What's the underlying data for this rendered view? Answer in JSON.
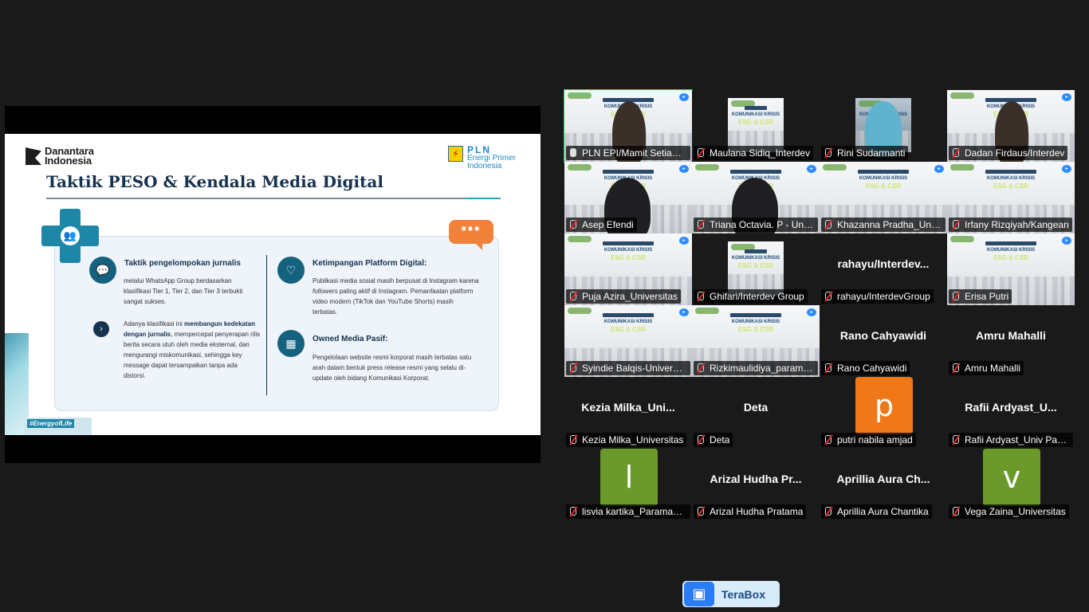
{
  "slide": {
    "logo_left": "Danantara\nIndonesia",
    "logo_left_line1": "Danantara",
    "logo_left_line2": "Indonesia",
    "logo_right_line1": "PLN",
    "logo_right_line2": "Energi Primer",
    "logo_right_line3": "Indonesia",
    "title": "Taktik PESO & Kendala Media Digital",
    "hashtag": "#EnergyofLife",
    "sections": {
      "s1_head": "Taktik pengelompokan jurnalis",
      "s1_body": "melalui WhatsApp Group berdasarkan klasifikasi Tier 1, Tier 2, dan Tier 3 terbukti sangat sukses.",
      "s2_body_a": "Adanya klasifikasi ini ",
      "s2_body_b": "membangun kedekatan dengan jurnalis",
      "s2_body_c": ", mempercepat penyerapan rilis berita secara utuh oleh media eksternal, dan mengurangi miskomunikasi, sehingga key message dapat tersampaikan tanpa ada distorsi.",
      "s3_head": "Ketimpangan Platform Digital:",
      "s3_body_a": "Publikasi media sosial masih berpusat di Instagram karena ",
      "s3_body_b": "followers",
      "s3_body_c": " paling aktif di Instagram. Pemanfaatan platform video modern (TikTok dan YouTube Shorts) masih terbatas.",
      "s4_head": "Owned Media Pasif:",
      "s4_body": "Pengelolaan website resmi korporat masih terbatas satu arah dalam bentuk press release resmi yang selalu di-update oleh bidang Komunikasi Korporat."
    }
  },
  "video_caption": {
    "line1": "KOMUNIKASI KRISIS",
    "line2": "ESG & CSR"
  },
  "participants": [
    {
      "name": "PLN EPI/Mamit Setiawan",
      "mic": "on",
      "kind": "video-person",
      "active": true
    },
    {
      "name": "Maulana Sidiq_Interdev",
      "mic": "off",
      "kind": "video-narrow"
    },
    {
      "name": "Rini Sudarmanti",
      "mic": "off",
      "kind": "video-person-hijab"
    },
    {
      "name": "Dadan Firdaus/Interdev",
      "mic": "off",
      "kind": "video-person"
    },
    {
      "name": "Asep Efendi",
      "mic": "off",
      "kind": "video-person-low"
    },
    {
      "name": "Triana Octavia. P - Universitas",
      "mic": "off",
      "kind": "video-person-low"
    },
    {
      "name": "Khazanna Pradha_Universitas",
      "mic": "off",
      "kind": "video"
    },
    {
      "name": "Irfany Rizqiyah/Kangean",
      "mic": "off",
      "kind": "video"
    },
    {
      "name": "Puja Azira_Universitas",
      "mic": "off",
      "kind": "video"
    },
    {
      "name": "Ghifari/Interdev Group",
      "mic": "off",
      "kind": "video-narrow"
    },
    {
      "name": "rahayu/InterdevGroup",
      "mic": "off",
      "kind": "name",
      "big": "rahayu/Interdev..."
    },
    {
      "name": "Erisa Putri",
      "mic": "off",
      "kind": "video"
    },
    {
      "name": "Syindie Balqis-Universitas",
      "mic": "off",
      "kind": "video"
    },
    {
      "name": "Rizkimaulidiya_paramadina",
      "mic": "off",
      "kind": "video"
    },
    {
      "name": "Rano Cahyawidi",
      "mic": "off",
      "kind": "name",
      "big": "Rano Cahyawidi"
    },
    {
      "name": "Amru Mahalli",
      "mic": "off",
      "kind": "name",
      "big": "Amru Mahalli"
    },
    {
      "name": "Kezia Milka_Universitas",
      "mic": "off",
      "kind": "name",
      "big": "Kezia  Milka_Uni..."
    },
    {
      "name": "Deta",
      "mic": "off",
      "kind": "name",
      "big": "Deta"
    },
    {
      "name": "putri nabila amjad",
      "mic": "off",
      "kind": "avatar",
      "letter": "p",
      "color": "#f07818"
    },
    {
      "name": "Rafii Ardyast_Univ Paramadina",
      "mic": "off",
      "kind": "name",
      "big": "Rafii  Ardyast_U..."
    },
    {
      "name": "lisvia kartika_Paramadina",
      "mic": "off",
      "kind": "avatar",
      "letter": "l",
      "color": "#6b9a2a"
    },
    {
      "name": "Arizal Hudha Pratama",
      "mic": "off",
      "kind": "name",
      "big": "Arizal  Hudha  Pr..."
    },
    {
      "name": "Aprillia Aura Chantika",
      "mic": "off",
      "kind": "name",
      "big": "Aprillia  Aura  Ch..."
    },
    {
      "name": "Vega Zaina_Universitas",
      "mic": "off",
      "kind": "avatar",
      "letter": "v",
      "color": "#6b9a2a"
    }
  ],
  "terabox": {
    "label": "TeraBox",
    "icon": "terabox-icon"
  },
  "colors": {
    "background": "#1a1a1a",
    "active_speaker": "#23d959",
    "mute_red": "#e02828",
    "slide_navy": "#15324f",
    "slide_teal": "#1e86a6",
    "slide_orange": "#f0823a"
  }
}
